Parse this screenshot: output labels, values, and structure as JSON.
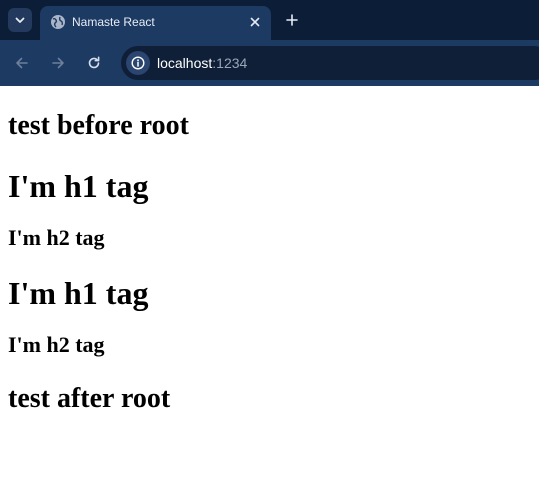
{
  "browser": {
    "tab": {
      "title": "Namaste React",
      "favicon": "globe-icon"
    },
    "address": {
      "host": "localhost",
      "port": ":1234"
    },
    "colors": {
      "frame": "#0c1d38",
      "toolbar": "#1d3a63",
      "omnibox": "#0f1f38"
    }
  },
  "page": {
    "before_root": "test before root",
    "blocks": [
      {
        "h1": "I'm h1 tag",
        "h2": "I'm h2 tag"
      },
      {
        "h1": "I'm h1 tag",
        "h2": "I'm h2 tag"
      }
    ],
    "after_root": "test after root"
  }
}
